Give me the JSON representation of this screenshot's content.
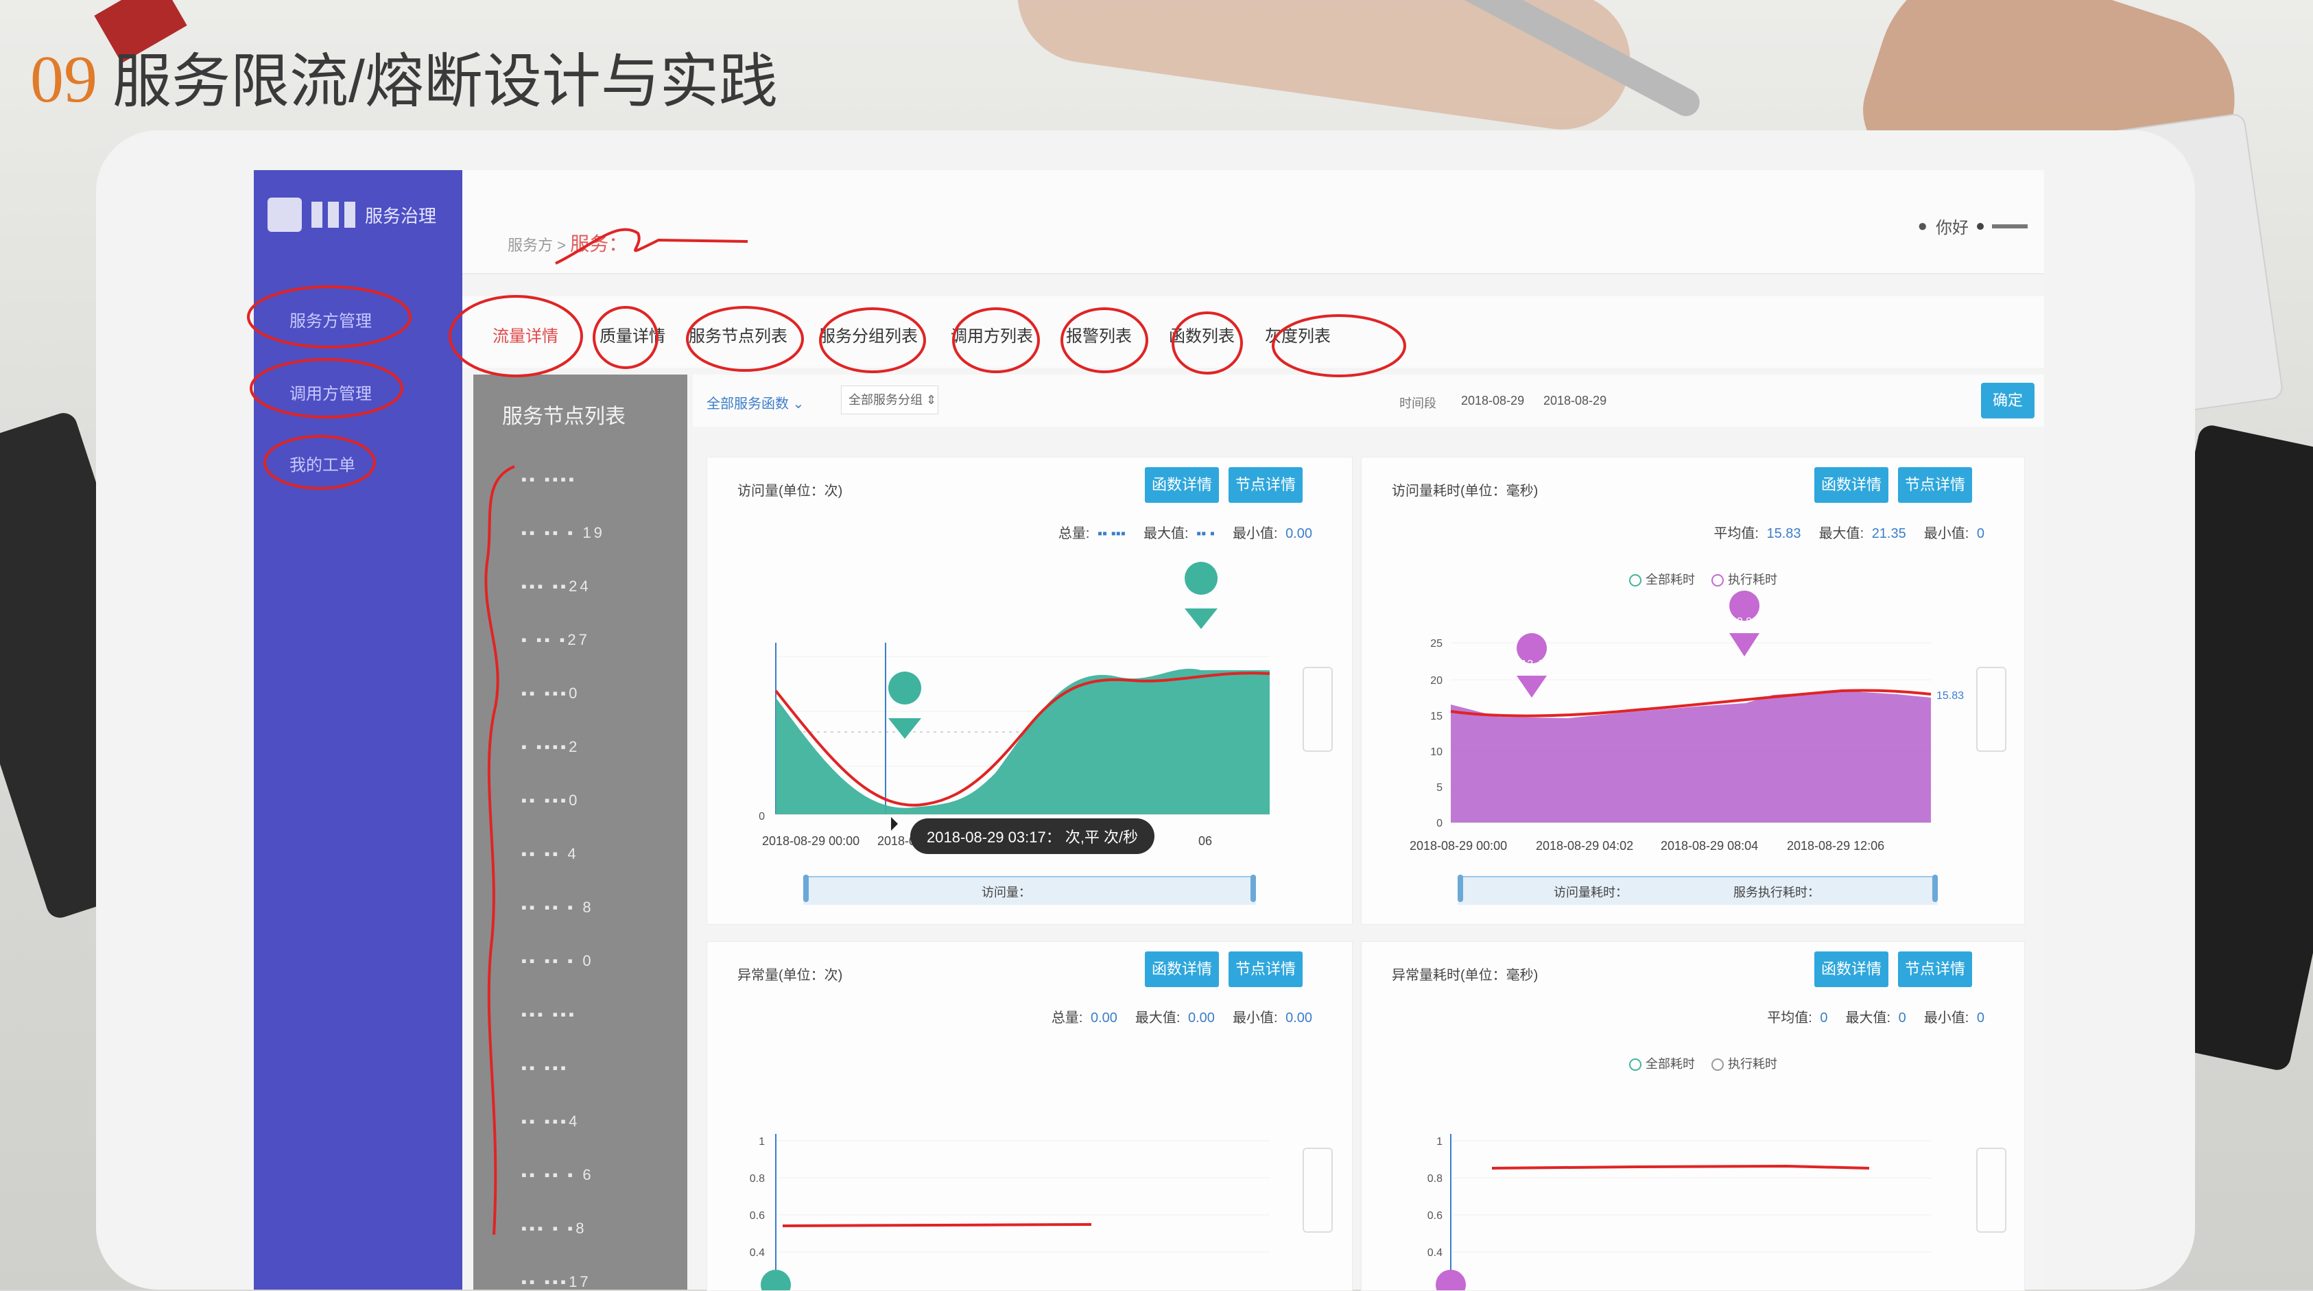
{
  "slide": {
    "number": "09",
    "title": "服务限流/熔断设计与实践"
  },
  "app": {
    "logo_text": "服务治理",
    "sidebar": [
      "服务方管理",
      "调用方管理",
      "我的工单"
    ],
    "breadcrumb": {
      "prefix": "服务方 >",
      "current": "服务："
    },
    "user": "你好",
    "tabs": [
      "流量详情",
      "质量详情",
      "服务节点列表",
      "服务分组列表",
      "调用方列表",
      "报警列表",
      "函数列表",
      "灰度列表"
    ],
    "node_panel_title": "服务节点列表",
    "nodes": [
      "▪▪ ▪▪▪▪",
      "▪▪ ▪▪ ▪ 19",
      "▪▪▪ ▪▪24",
      "▪ ▪▪ ▪27",
      "▪▪ ▪▪▪0",
      "▪ ▪▪▪▪2",
      "▪▪ ▪▪▪0",
      "▪▪ ▪▪ 4",
      "▪▪ ▪▪ ▪ 8",
      "▪▪ ▪▪ ▪ 0",
      "▪▪▪ ▪▪▪",
      "▪▪ ▪▪▪",
      "▪▪ ▪▪▪4",
      "▪▪ ▪▪ ▪ 6",
      "▪▪▪ ▪ ▪8",
      "▪▪ ▪▪▪17"
    ],
    "filter": {
      "func_select": "全部服务函数",
      "group_select": "全部服务分组",
      "time_label": "时间段",
      "date_from": "2018-08-29",
      "date_to": "2018-08-29",
      "confirm": "确定"
    },
    "buttons": {
      "func_detail": "函数详情",
      "node_detail": "节点详情"
    },
    "cards": [
      {
        "title": "访问量(单位：次)",
        "stats": {
          "total_label": "总量",
          "max_label": "最大值",
          "min_label": "最小值",
          "min": "0.00"
        },
        "x_ticks": [
          "2018-08-29 00:00",
          "2018-08"
        ],
        "y_ticks": [
          "0"
        ],
        "tooltip": "2018-08-29 03:17：  次,平  次/秒",
        "x_tick_right": "06",
        "scrub_label": "访问量："
      },
      {
        "title": "访问量耗时(单位：毫秒)",
        "stats": {
          "avg_label": "平均值",
          "avg": "15.83",
          "max_label": "最大值",
          "max": "21.35",
          "min_label": "最小值",
          "min": "0"
        },
        "legend": [
          "全部耗时",
          "执行耗时"
        ],
        "y_ticks": [
          "25",
          "20",
          "15",
          "10",
          "5",
          "0"
        ],
        "x_ticks": [
          "2018-08-29 00:00",
          "2018-08-29 04:02",
          "2018-08-29 08:04",
          "2018-08-29 12:06"
        ],
        "markers": [
          "13.4",
          "20.91"
        ],
        "right_value": "15.83",
        "scrub_label_1": "访问量耗时：",
        "scrub_label_2": "服务执行耗时："
      },
      {
        "title": "异常量(单位：次)",
        "stats": {
          "total_label": "总量",
          "total": "0.00",
          "max_label": "最大值",
          "max": "0.00",
          "min_label": "最小值",
          "min": "0.00"
        },
        "y_ticks": [
          "1",
          "0.8",
          "0.6",
          "0.4"
        ]
      },
      {
        "title": "异常量耗时(单位：毫秒)",
        "stats": {
          "avg_label": "平均值",
          "avg": "0",
          "max_label": "最大值",
          "max": "0",
          "min_label": "最小值",
          "min": "0"
        },
        "legend": [
          "全部耗时",
          "执行耗时"
        ],
        "y_ticks": [
          "1",
          "0.8",
          "0.6",
          "0.4"
        ]
      }
    ]
  },
  "colors": {
    "sidebar": "#4d4fc2",
    "accent": "#2fa7dc",
    "teal": "#3fb39d",
    "purple": "#b86ad0",
    "annotation": "#e02424",
    "slide_number": "#e07b2a"
  }
}
